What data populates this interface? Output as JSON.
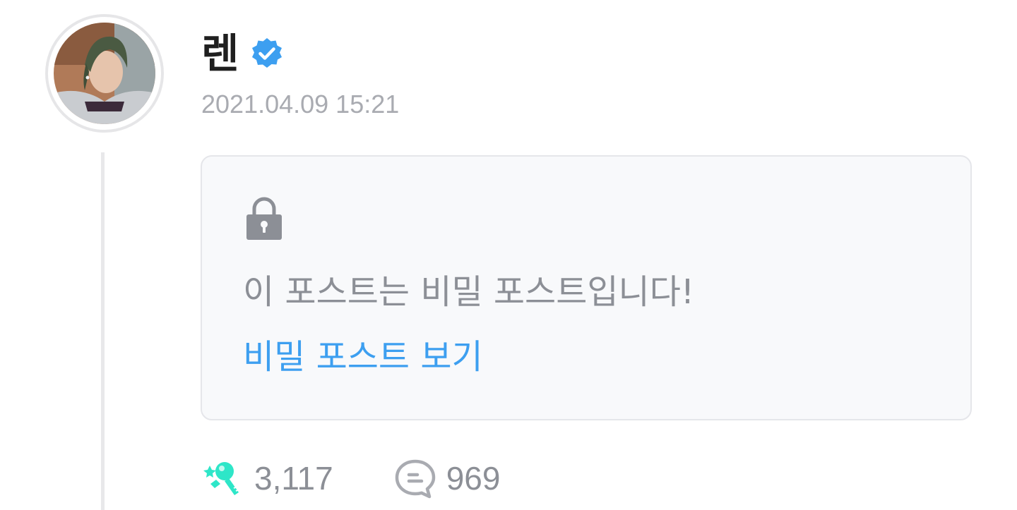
{
  "author": {
    "name": "렌",
    "verified": true,
    "verified_color": "#3d9ff0"
  },
  "timestamp": "2021.04.09 15:21",
  "secret_post": {
    "message": "이 포스트는 비밀 포스트입니다!",
    "link_label": "비밀 포스트 보기",
    "lock_icon": "lock-icon",
    "link_color": "#3d9ff0"
  },
  "stats": {
    "likes": "3,117",
    "likes_icon": "key-heart-icon",
    "likes_icon_color": "#2ee6c8",
    "comments": "969",
    "comments_icon": "comment-bubble-icon"
  }
}
